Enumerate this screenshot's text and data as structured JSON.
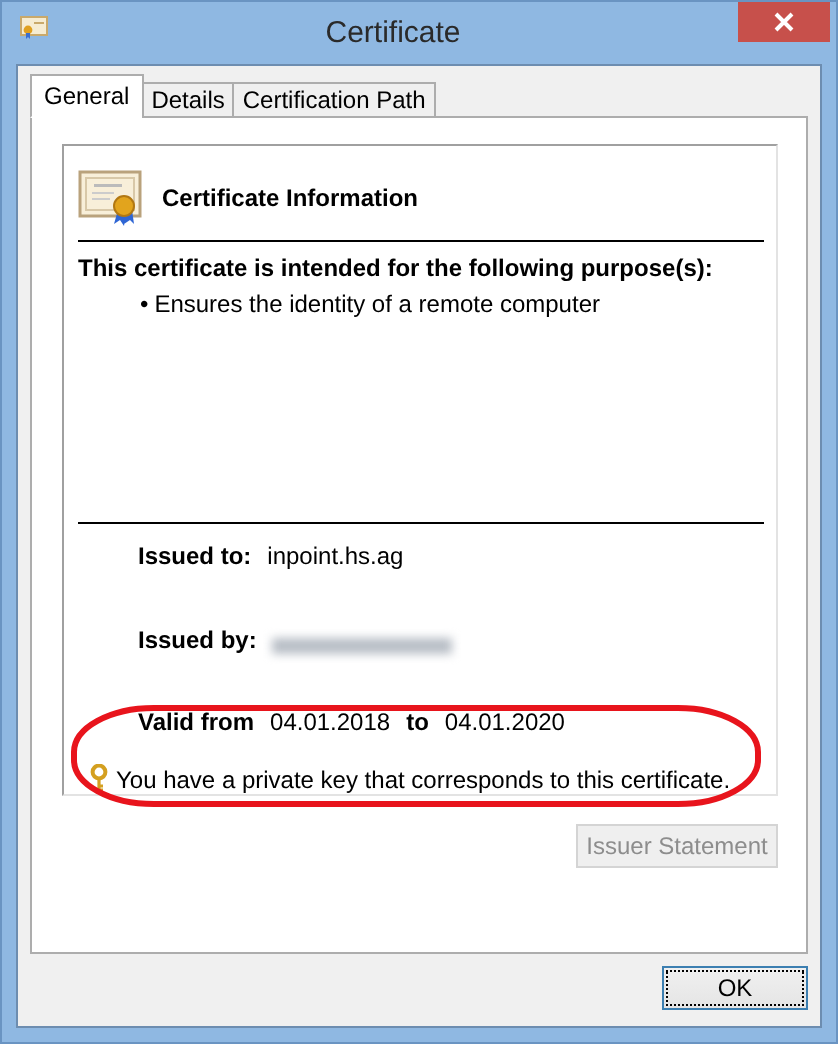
{
  "window": {
    "title": "Certificate"
  },
  "tabs": [
    {
      "label": "General",
      "selected": true
    },
    {
      "label": "Details",
      "selected": false
    },
    {
      "label": "Certification Path",
      "selected": false
    }
  ],
  "info_title": "Certificate Information",
  "purpose_heading": "This certificate is intended for the following purpose(s):",
  "purposes": [
    {
      "bullet": "•",
      "text": "Ensures the identity of a remote computer"
    }
  ],
  "issued_to": {
    "label": "Issued to:",
    "value": "inpoint.hs.ag"
  },
  "issued_by": {
    "label": "Issued by:",
    "redacted": true
  },
  "validity": {
    "from_label": "Valid from",
    "from": "04.01.2018",
    "to_label": "to",
    "to": "04.01.2020"
  },
  "private_key_note": "You have a private key that corresponds to this certificate.",
  "issuer_statement_button": {
    "label": "Issuer Statement",
    "disabled": true
  },
  "ok_button": {
    "label": "OK",
    "focused": true
  },
  "annotation": {
    "kind": "ellipse"
  }
}
